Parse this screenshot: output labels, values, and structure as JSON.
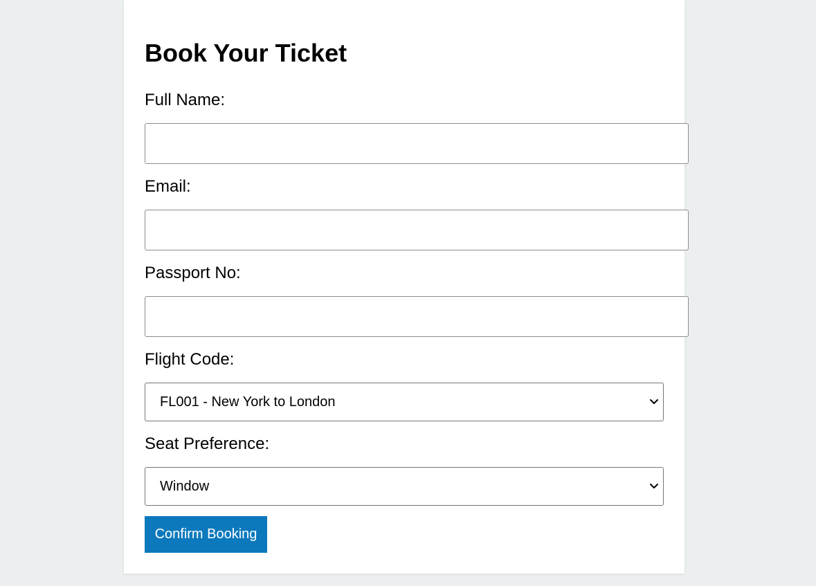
{
  "form": {
    "title": "Book Your Ticket",
    "full_name": {
      "label": "Full Name:",
      "value": ""
    },
    "email": {
      "label": "Email:",
      "value": ""
    },
    "passport": {
      "label": "Passport No:",
      "value": ""
    },
    "flight_code": {
      "label": "Flight Code:",
      "selected": "FL001 - New York to London"
    },
    "seat_preference": {
      "label": "Seat Preference:",
      "selected": "Window"
    },
    "submit_label": "Confirm Booking"
  },
  "colors": {
    "page_background": "#eceff0",
    "card_background": "#ffffff",
    "button_background": "#0c79bd",
    "button_text": "#ffffff"
  },
  "icons": {
    "flight_select": "chevron-down-icon",
    "seat_select": "chevron-down-icon"
  }
}
